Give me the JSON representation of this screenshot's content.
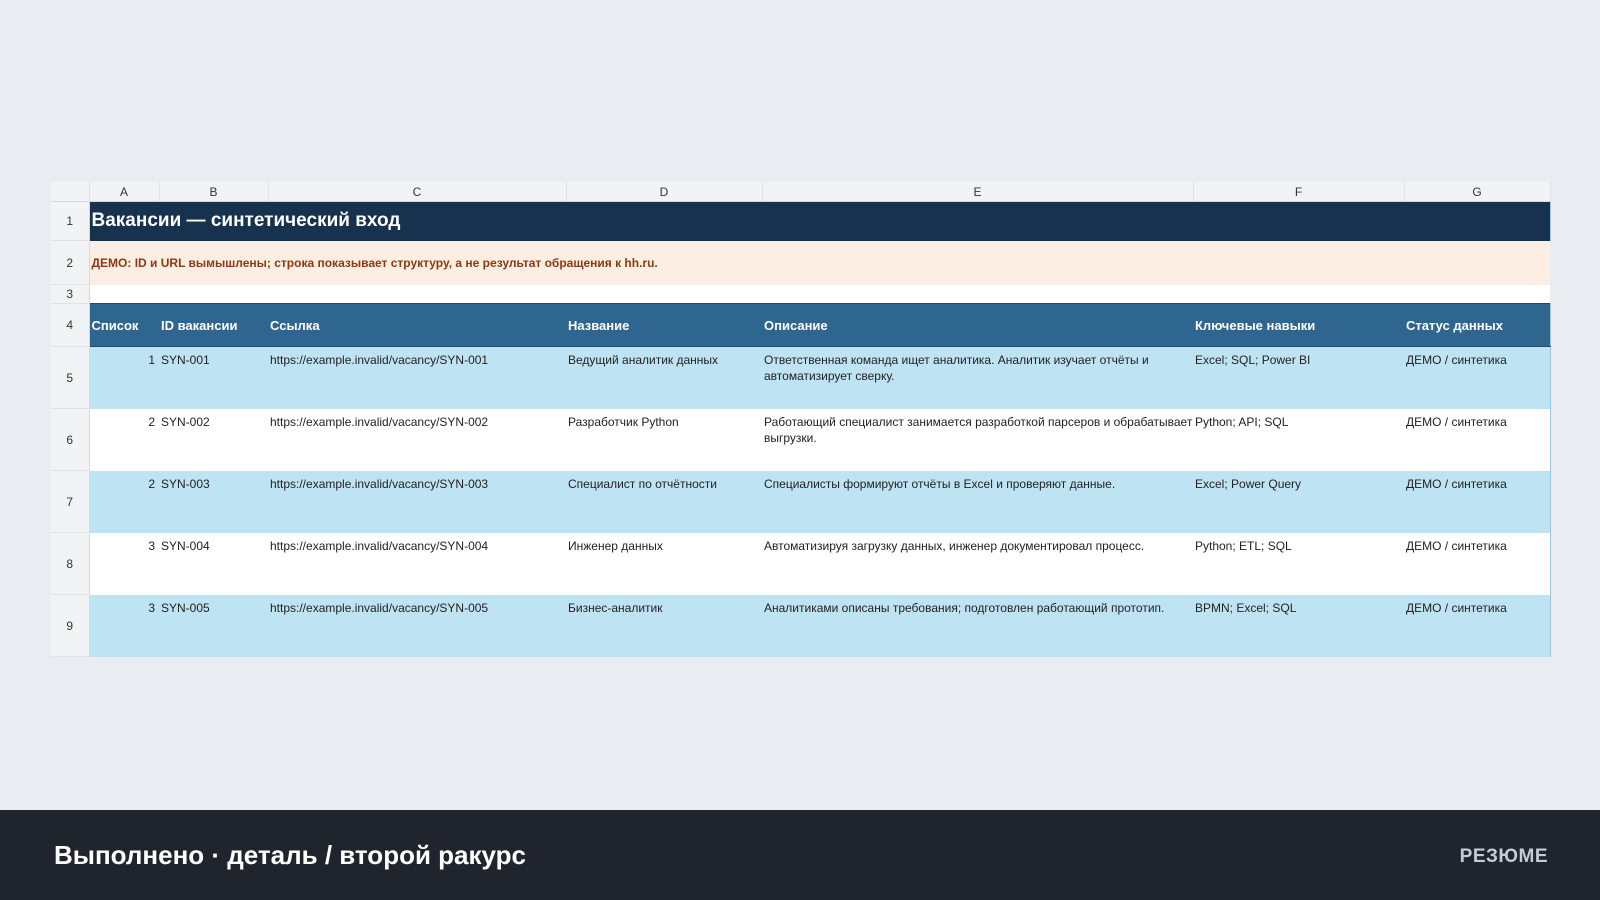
{
  "sheet": {
    "columns": [
      "A",
      "B",
      "C",
      "D",
      "E",
      "F",
      "G"
    ],
    "row_numbers": [
      "1",
      "2",
      "3",
      "4",
      "5",
      "6",
      "7",
      "8",
      "9"
    ],
    "title": "Вакансии — синтетический вход",
    "demo_note": "ДЕМО: ID и URL вымышлены; строка показывает структуру, а не результат обращения к hh.ru.",
    "headers": [
      "Список",
      "ID вакансии",
      "Ссылка",
      "Название",
      "Описание",
      "Ключевые навыки",
      "Статус данных"
    ],
    "rows": [
      [
        "1",
        "SYN-001",
        "https://example.invalid/vacancy/SYN-001",
        "Ведущий аналитик данных",
        "Ответственная команда ищет аналитика. Аналитик изучает отчёты и автоматизирует сверку.",
        "Excel; SQL; Power BI",
        "ДЕМО / синтетика"
      ],
      [
        "2",
        "SYN-002",
        "https://example.invalid/vacancy/SYN-002",
        "Разработчик Python",
        "Работающий специалист занимается разработкой парсеров и обрабатывает выгрузки.",
        "Python; API; SQL",
        "ДЕМО / синтетика"
      ],
      [
        "2",
        "SYN-003",
        "https://example.invalid/vacancy/SYN-003",
        "Специалист по отчётности",
        "Специалисты формируют отчёты в Excel и проверяют данные.",
        "Excel; Power Query",
        "ДЕМО / синтетика"
      ],
      [
        "3",
        "SYN-004",
        "https://example.invalid/vacancy/SYN-004",
        "Инженер данных",
        "Автоматизируя загрузку данных, инженер документировал процесс.",
        "Python; ETL; SQL",
        "ДЕМО / синтетика"
      ],
      [
        "3",
        "SYN-005",
        "https://example.invalid/vacancy/SYN-005",
        "Бизнес-аналитик",
        "Аналитиками описаны требования; подготовлен работающий прототип.",
        "BPMN; Excel; SQL",
        "ДЕМО / синтетика"
      ]
    ]
  },
  "footer": {
    "caption": "Выполнено · деталь / второй ракурс",
    "tag": "РЕЗЮМЕ"
  }
}
